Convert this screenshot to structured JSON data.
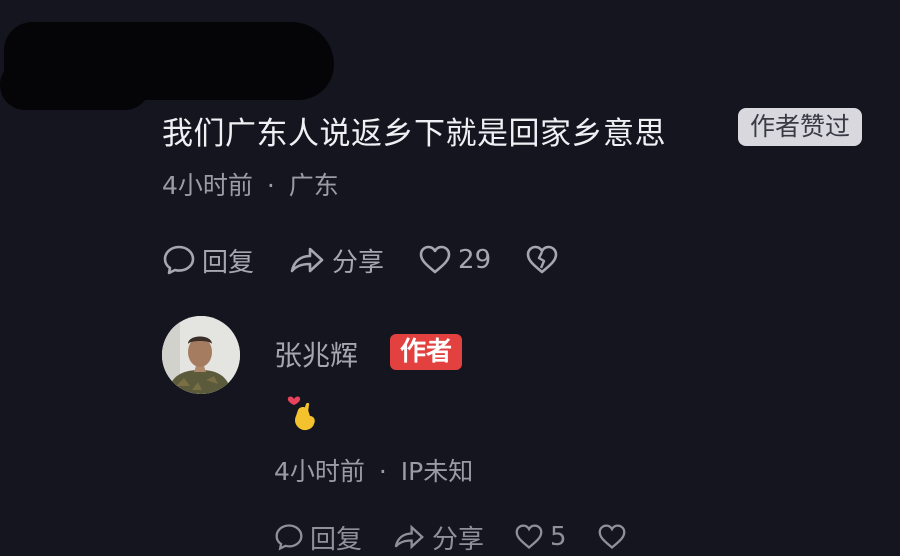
{
  "top_comment": {
    "text": "我们广东人说返乡下就是回家乡意思",
    "liked_badge": "作者赞过",
    "time": "4小时前",
    "separator": "·",
    "location": "广东",
    "actions": {
      "reply": "回复",
      "share": "分享",
      "likes": "29"
    }
  },
  "reply": {
    "username": "张兆辉",
    "author_badge": "作者",
    "content_icon": "finger-heart-emoji",
    "time": "4小时前",
    "separator": "·",
    "location": "IP未知",
    "actions": {
      "reply": "回复",
      "share": "分享",
      "likes": "5"
    }
  },
  "colors": {
    "background": "#15151f",
    "author_badge": "#e2413f",
    "liked_badge": "#d8d8de"
  }
}
